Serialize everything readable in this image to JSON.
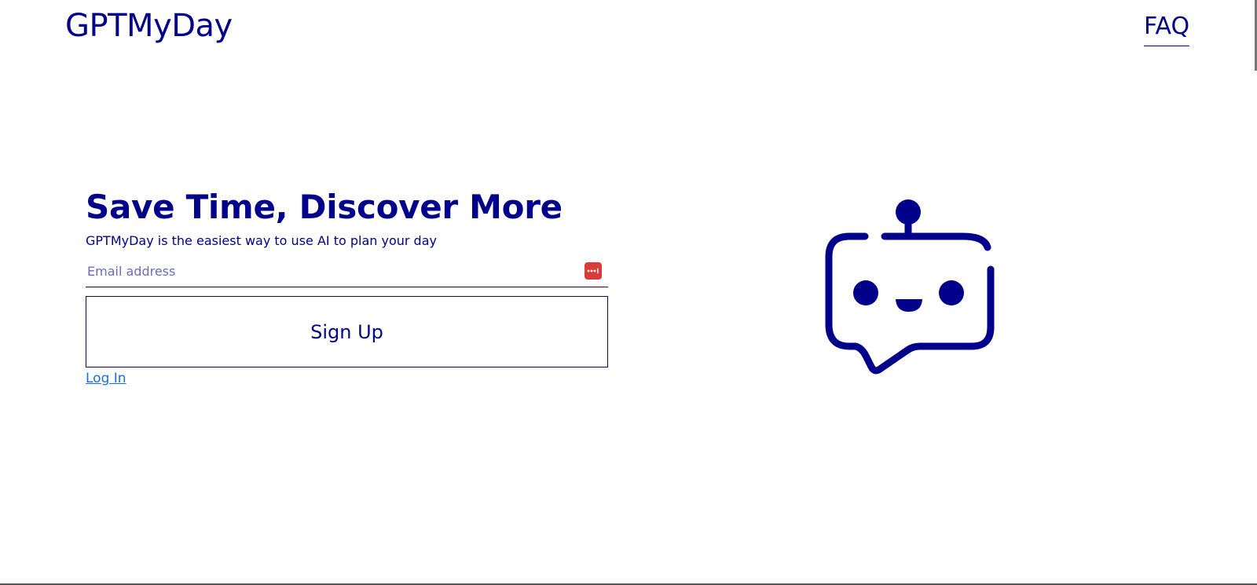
{
  "header": {
    "brand": "GPTMyDay",
    "faq_label": "FAQ"
  },
  "hero": {
    "headline": "Save Time, Discover More",
    "subtitle": "GPTMyDay is the easiest way to use AI to plan your day",
    "email_placeholder": "Email address",
    "email_value": "",
    "signup_label": "Sign Up",
    "login_label": "Log In"
  },
  "icons": {
    "password_manager": "password-manager-icon",
    "robot": "robot-chat-icon"
  },
  "colors": {
    "primary": "#00008b",
    "link": "#1a6fd6",
    "password_manager": "#d93a3a",
    "background": "#ffffff"
  }
}
